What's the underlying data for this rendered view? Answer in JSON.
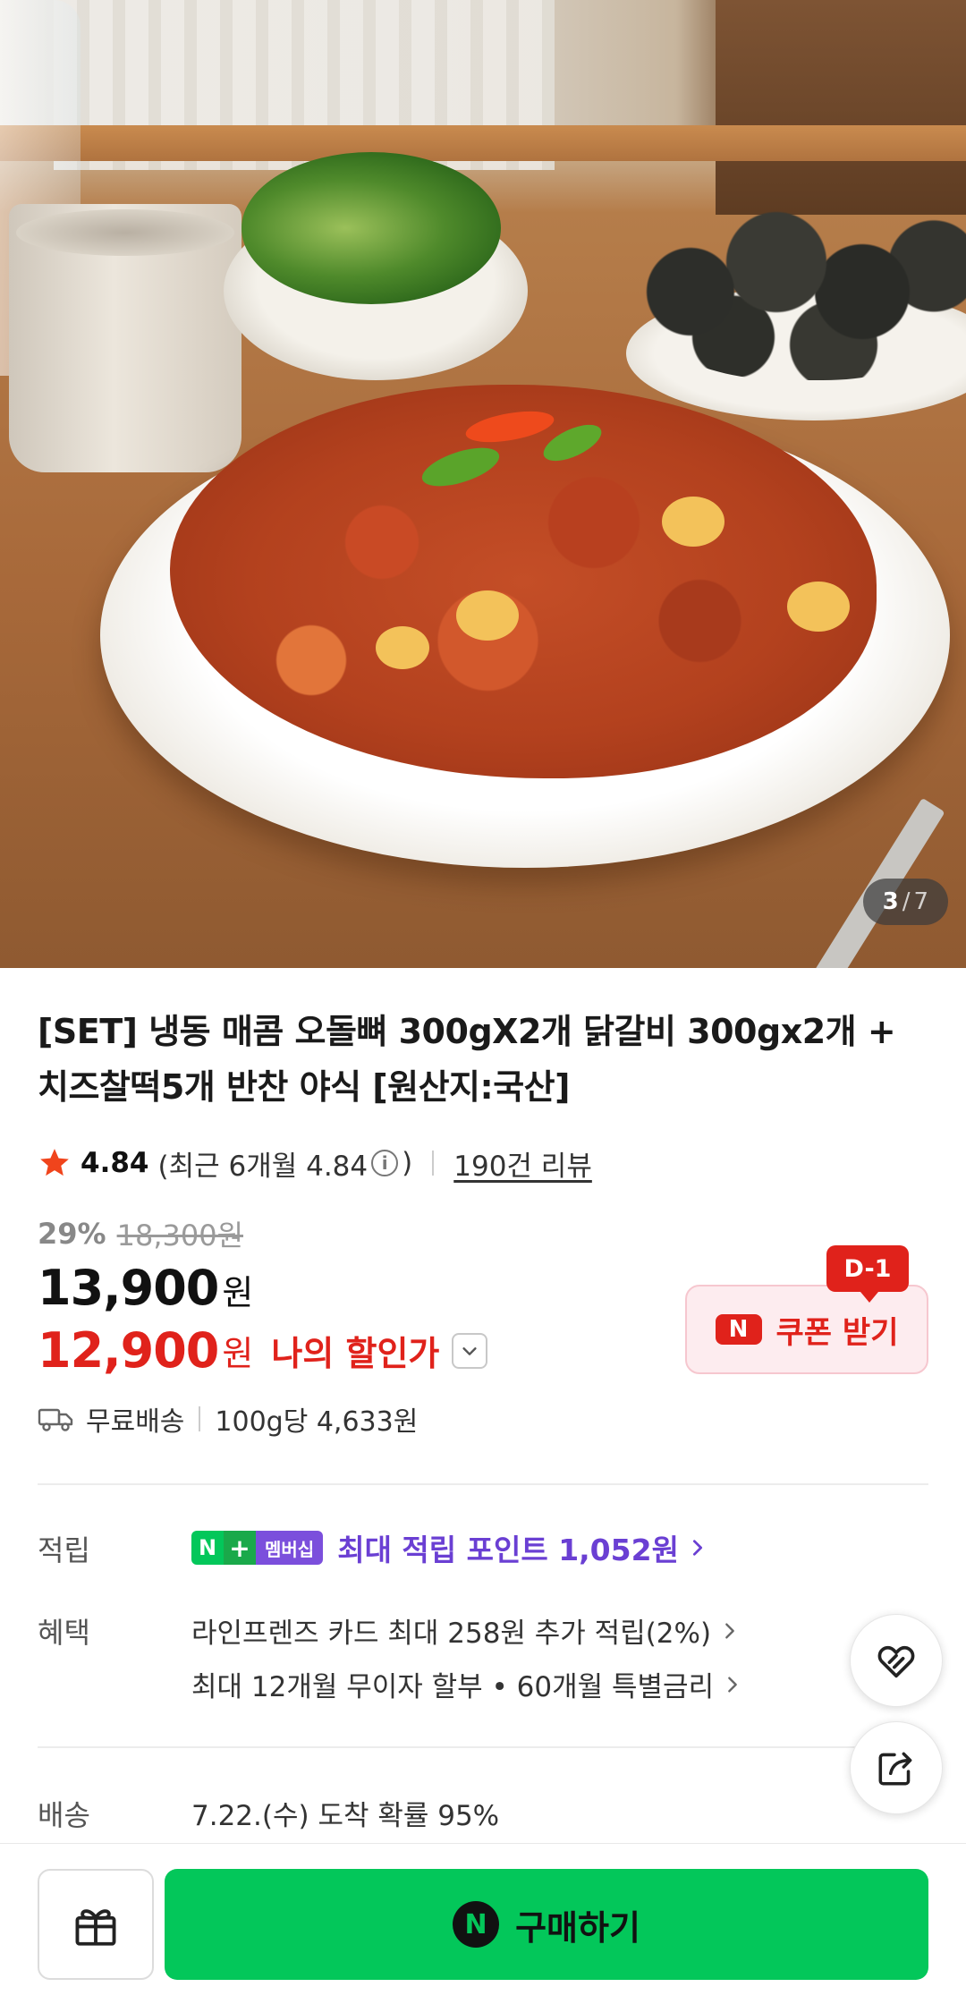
{
  "gallery": {
    "current": "3",
    "separator": "/",
    "total": "7"
  },
  "product": {
    "title": "[SET] 냉동 매콤 오돌뼈 300gX2개 닭갈비 300gx2개 + 치즈찰떡5개 반찬 야식 [원산지:국산]"
  },
  "rating": {
    "score": "4.84",
    "recent_open": "(최근 6개월 4.84",
    "info_glyph": "i",
    "recent_close": ")",
    "review_link": "190건 리뷰"
  },
  "price": {
    "discount_rate": "29%",
    "original": "18,300원",
    "sale": "13,900",
    "sale_unit": "원",
    "my_price": "12,900",
    "my_price_unit": "원",
    "my_price_label": "나의 할인가"
  },
  "coupon": {
    "badge": "D-1",
    "n_glyph": "N",
    "label": "쿠폰 받기"
  },
  "shipping": {
    "free": "무료배송",
    "unit_price": "100g당 4,633원"
  },
  "points": {
    "label": "적립",
    "badge_n": "N",
    "badge_plus": "+",
    "badge_member": "멤버십",
    "text": "최대 적립 포인트 1,052원"
  },
  "benefits": {
    "label": "혜택",
    "items": [
      "라인프렌즈 카드 최대 258원 추가 적립(2%)",
      "최대 12개월 무이자 할부 • 60개월 특별금리"
    ]
  },
  "delivery": {
    "label": "배송",
    "text": "7.22.(수) 도착 확률 95%"
  },
  "bottom": {
    "buy_n_glyph": "N",
    "buy_label": "구매하기"
  },
  "colors": {
    "naver_green": "#03c75a",
    "sale_red": "#e0221b",
    "membership_purple": "#6a3fd3"
  },
  "icons": [
    "star-icon",
    "info-icon",
    "chevron-down-icon",
    "truck-icon",
    "chevron-right-icon",
    "heart-link-icon",
    "share-icon",
    "gift-icon"
  ]
}
